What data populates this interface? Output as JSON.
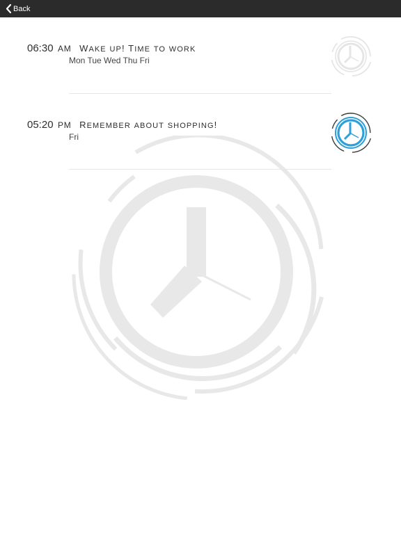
{
  "navbar": {
    "back_label": "Back"
  },
  "alarms": [
    {
      "time": "06:30",
      "ampm": "AM",
      "label": "Wake up! Time to work",
      "days": "Mon Tue Wed Thu Fri",
      "enabled": false
    },
    {
      "time": "05:20",
      "ampm": "PM",
      "label": "Remember about shopping!",
      "days": "Fri",
      "enabled": true
    }
  ],
  "colors": {
    "navbar_bg": "#2b2b2b",
    "accent": "#2e9fd8",
    "inactive": "#e5e5e5",
    "watermark": "#e8e8e8"
  },
  "icons": {
    "back": "chevron-left-icon",
    "alarm_toggle": "alarm-clock-icon",
    "background": "clock-watermark-icon"
  }
}
